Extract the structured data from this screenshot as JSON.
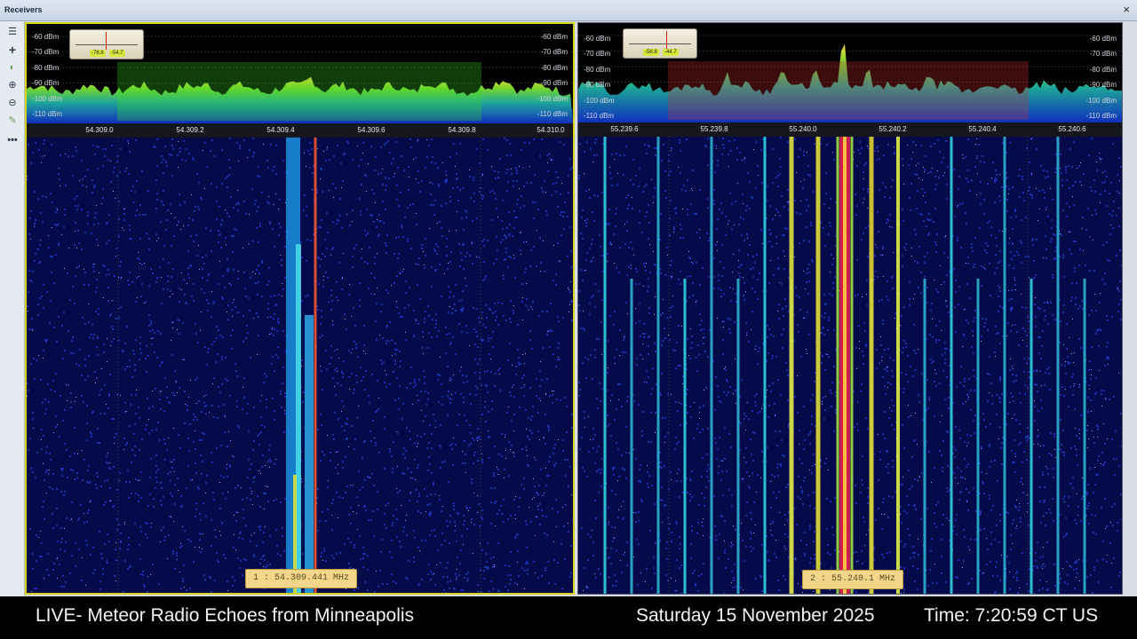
{
  "window": {
    "title": "Receivers",
    "close_icon": "close-icon"
  },
  "toolbar": {
    "icons": [
      "menu-icon",
      "add-icon",
      "receiver-icon",
      "zoom-in-icon",
      "zoom-out-icon",
      "edit-icon",
      "more-icon"
    ]
  },
  "receivers": [
    {
      "id": 1,
      "db_levels": [
        "-60 dBm",
        "-70 dBm",
        "-80 dBm",
        "-90 dBm",
        "-100 dBm",
        "-110 dBm"
      ],
      "freq_ticks": [
        "54.309.0",
        "54.309.2",
        "54.309.4",
        "54.309.6",
        "54.309.8",
        "54.310.0"
      ],
      "smeter": {
        "readout_a": "-76.6",
        "readout_b": "-54.7"
      },
      "freq_label": "1 : 54.309.441 MHz",
      "passband_color": "#3adf22"
    },
    {
      "id": 2,
      "db_levels": [
        "-60 dBm",
        "-70 dBm",
        "-80 dBm",
        "-90 dBm",
        "-100 dBm",
        "-110 dBm"
      ],
      "freq_ticks": [
        "55.239.6",
        "55.239.8",
        "55.240.0",
        "55.240.2",
        "55.240.4",
        "55.240.6"
      ],
      "smeter": {
        "readout_a": "-58.8",
        "readout_b": "-44.7"
      },
      "freq_label": "2 : 55.240.1 MHz",
      "passband_color": "#d23030"
    }
  ],
  "footer": {
    "stream_title": "LIVE- Meteor Radio Echoes from Minneapolis",
    "date": "Saturday 15 November 2025",
    "time": "Time: 7:20:59 CT US"
  }
}
